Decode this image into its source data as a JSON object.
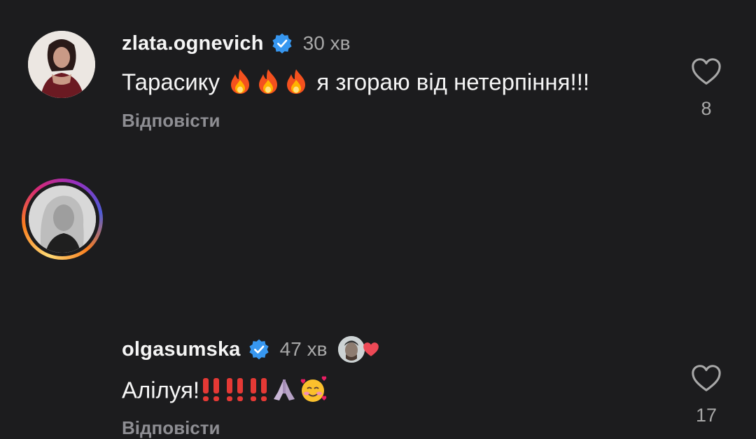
{
  "comments": [
    {
      "username": "zlata.ognevich",
      "time": "30 хв",
      "text_before": "Тарасику",
      "text_after": "я згораю від нетерпіння!!!",
      "reply_label": "Відповісти",
      "likes": "8",
      "icons": [
        "verified-badge-icon",
        "fire-emoji",
        "heart-outline-icon"
      ]
    },
    {
      "username": "olgasumska",
      "time": "47 хв",
      "text_before": "Алілуя!",
      "reply_label": "Відповісти",
      "likes": "17",
      "icons": [
        "verified-badge-icon",
        "double-exclamation-emoji",
        "folded-hands-emoji",
        "smiling-face-with-hearts-emoji",
        "creator-liked-heart-icon",
        "heart-outline-icon"
      ]
    }
  ],
  "colors": {
    "background": "#1c1c1e",
    "verified": "#3797f0",
    "secondary_text": "#a8a8a8",
    "reply_text": "#8e8e93",
    "heart_red": "#ed4956"
  }
}
